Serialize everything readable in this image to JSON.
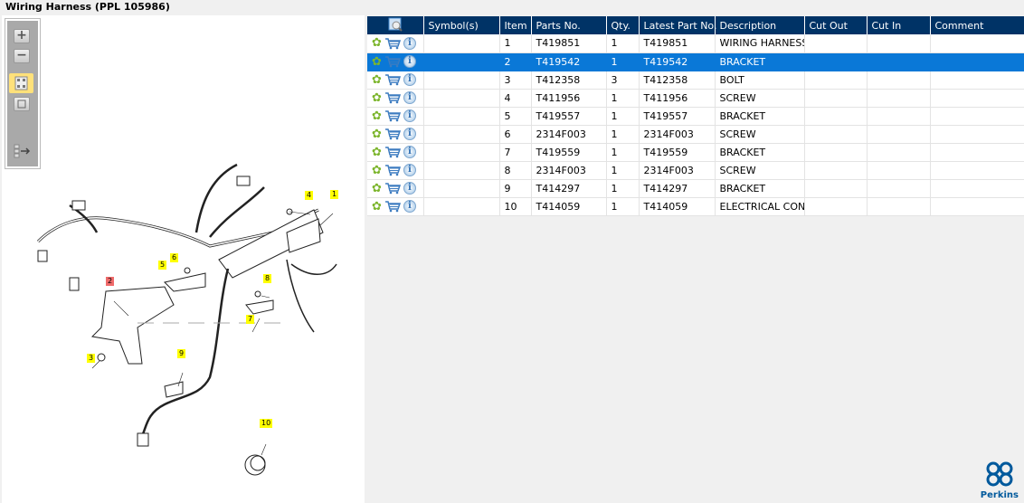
{
  "window": {
    "title": "Wiring Harness (PPL 105986)"
  },
  "toolbar": {
    "zoom_in": "+",
    "zoom_out": "−"
  },
  "diagram": {
    "callouts": [
      "1",
      "2",
      "3",
      "4",
      "5",
      "6",
      "7",
      "8",
      "9",
      "10"
    ],
    "selected_callout": "2"
  },
  "table": {
    "headers": [
      "Symbol(s)",
      "Item",
      "Parts No.",
      "Qty.",
      "Latest Part No.",
      "Description",
      "Cut Out",
      "Cut In",
      "Comment"
    ],
    "selected_row": 1,
    "rows": [
      {
        "symbol": "",
        "item": "1",
        "part": "T419851",
        "qty": "1",
        "latest": "T419851",
        "desc": "WIRING HARNESS",
        "cut_out": "",
        "cut_in": "",
        "comment": ""
      },
      {
        "symbol": "",
        "item": "2",
        "part": "T419542",
        "qty": "1",
        "latest": "T419542",
        "desc": "BRACKET",
        "cut_out": "",
        "cut_in": "",
        "comment": ""
      },
      {
        "symbol": "",
        "item": "3",
        "part": "T412358",
        "qty": "3",
        "latest": "T412358",
        "desc": "BOLT",
        "cut_out": "",
        "cut_in": "",
        "comment": ""
      },
      {
        "symbol": "",
        "item": "4",
        "part": "T411956",
        "qty": "1",
        "latest": "T411956",
        "desc": "SCREW",
        "cut_out": "",
        "cut_in": "",
        "comment": ""
      },
      {
        "symbol": "",
        "item": "5",
        "part": "T419557",
        "qty": "1",
        "latest": "T419557",
        "desc": "BRACKET",
        "cut_out": "",
        "cut_in": "",
        "comment": ""
      },
      {
        "symbol": "",
        "item": "6",
        "part": "2314F003",
        "qty": "1",
        "latest": "2314F003",
        "desc": "SCREW",
        "cut_out": "",
        "cut_in": "",
        "comment": ""
      },
      {
        "symbol": "",
        "item": "7",
        "part": "T419559",
        "qty": "1",
        "latest": "T419559",
        "desc": "BRACKET",
        "cut_out": "",
        "cut_in": "",
        "comment": ""
      },
      {
        "symbol": "",
        "item": "8",
        "part": "2314F003",
        "qty": "1",
        "latest": "2314F003",
        "desc": "SCREW",
        "cut_out": "",
        "cut_in": "",
        "comment": ""
      },
      {
        "symbol": "",
        "item": "9",
        "part": "T414297",
        "qty": "1",
        "latest": "T414297",
        "desc": "BRACKET",
        "cut_out": "",
        "cut_in": "",
        "comment": ""
      },
      {
        "symbol": "",
        "item": "10",
        "part": "T414059",
        "qty": "1",
        "latest": "T414059",
        "desc": "ELECTRICAL CONN",
        "cut_out": "",
        "cut_in": "",
        "comment": ""
      }
    ]
  },
  "brand": {
    "name": "Perkins",
    "color": "#00599c"
  }
}
